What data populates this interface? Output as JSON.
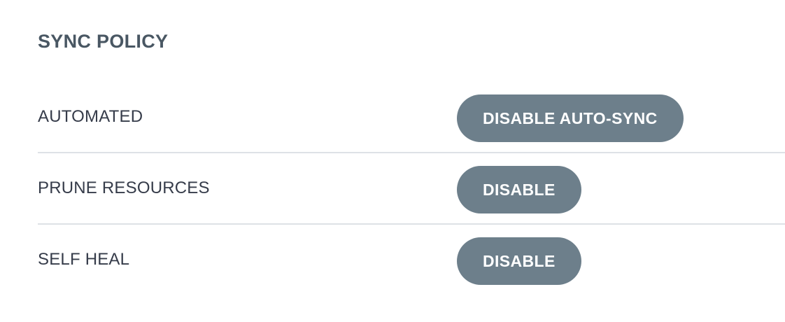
{
  "sync_policy": {
    "title": "SYNC POLICY",
    "rows": [
      {
        "label": "AUTOMATED",
        "button_label": "DISABLE AUTO-SYNC"
      },
      {
        "label": "PRUNE RESOURCES",
        "button_label": "DISABLE"
      },
      {
        "label": "SELF HEAL",
        "button_label": "DISABLE"
      }
    ]
  },
  "colors": {
    "button_bg": "#6d7f8b",
    "button_text": "#ffffff",
    "label_text": "#363c4a",
    "divider": "#dee2e6"
  }
}
